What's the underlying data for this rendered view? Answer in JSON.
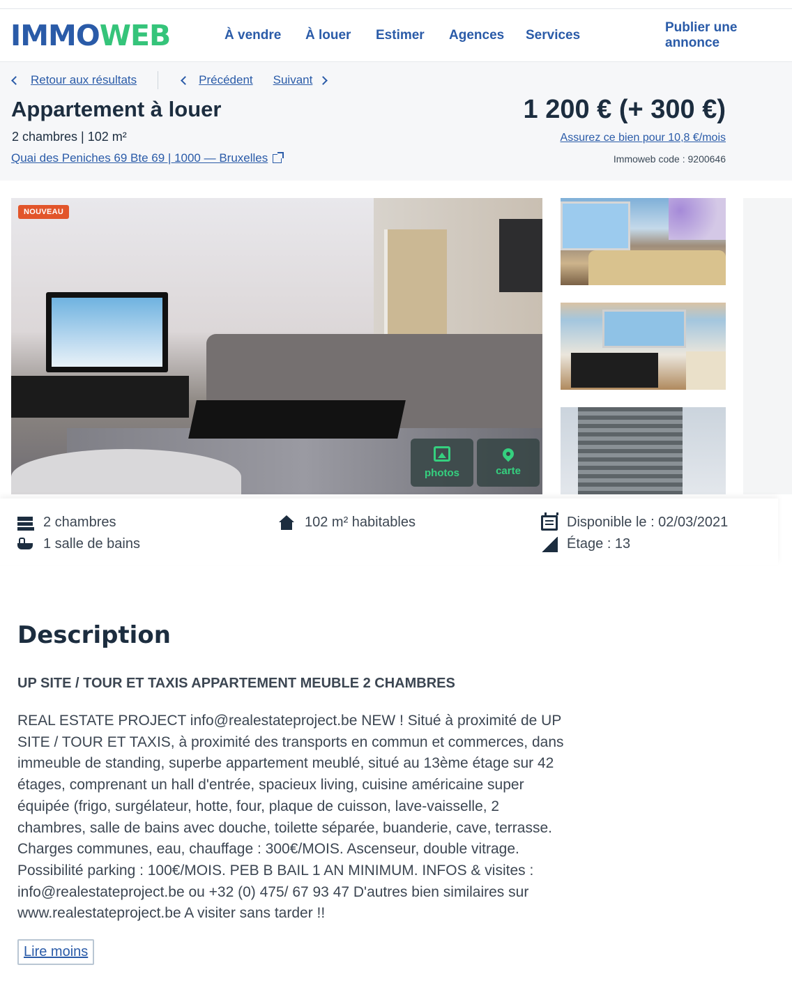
{
  "header": {
    "logo_part1": "IMMO",
    "logo_part2": "WEB",
    "nav": [
      "À vendre",
      "À louer",
      "Estimer",
      "Agences",
      "Services"
    ],
    "publish": "Publier une annonce"
  },
  "breadcrumb": {
    "back": "Retour aux résultats",
    "previous": "Précédent",
    "next": "Suivant"
  },
  "listing": {
    "title": "Appartement à louer",
    "subtitle": "2 chambres | 102 m²",
    "address": "Quai des Peniches 69 Bte 69 | 1000 — Bruxelles",
    "price": "1 200 € (+ 300 €)",
    "insurance": "Assurez ce bien pour 10,8 €/mois",
    "code": "Immoweb code : 9200646"
  },
  "gallery": {
    "badge": "NOUVEAU",
    "photos_label": "photos",
    "map_label": "carte"
  },
  "features": {
    "bedrooms": "2 chambres",
    "bathrooms": "1 salle de bains",
    "area": "102 m² habitables",
    "available": "Disponible le : 02/03/2021",
    "floor": "Étage : 13"
  },
  "description": {
    "heading": "Description",
    "subheading": "UP SITE / TOUR ET TAXIS APPARTEMENT MEUBLE 2 CHAMBRES",
    "body": "REAL ESTATE PROJECT info@realestateproject.be NEW ! Situé à proximité de UP SITE / TOUR ET TAXIS, à proximité des transports en commun et commerces, dans immeuble de standing, superbe appartement meublé, situé au 13ème étage sur 42 étages, comprenant un hall d'entrée, spacieux living, cuisine américaine super équipée (frigo, surgélateur, hotte, four, plaque de cuisson, lave-vaisselle, 2 chambres, salle de bains avec douche, toilette séparée, buanderie, cave, terrasse. Charges communes, eau, chauffage : 300€/MOIS. Ascenseur, double vitrage. Possibilité parking : 100€/MOIS. PEB B BAIL 1 AN MINIMUM. INFOS & visites : info@realestateproject.be ou +32 (0) 475/ 67 93 47 D'autres bien similaires sur www.realestateproject.be A visiter sans tarder !!",
    "toggle": "Lire moins"
  },
  "colors": {
    "brand_blue": "#2a5ba8",
    "brand_green": "#35c47a",
    "badge_orange": "#e2552a"
  }
}
